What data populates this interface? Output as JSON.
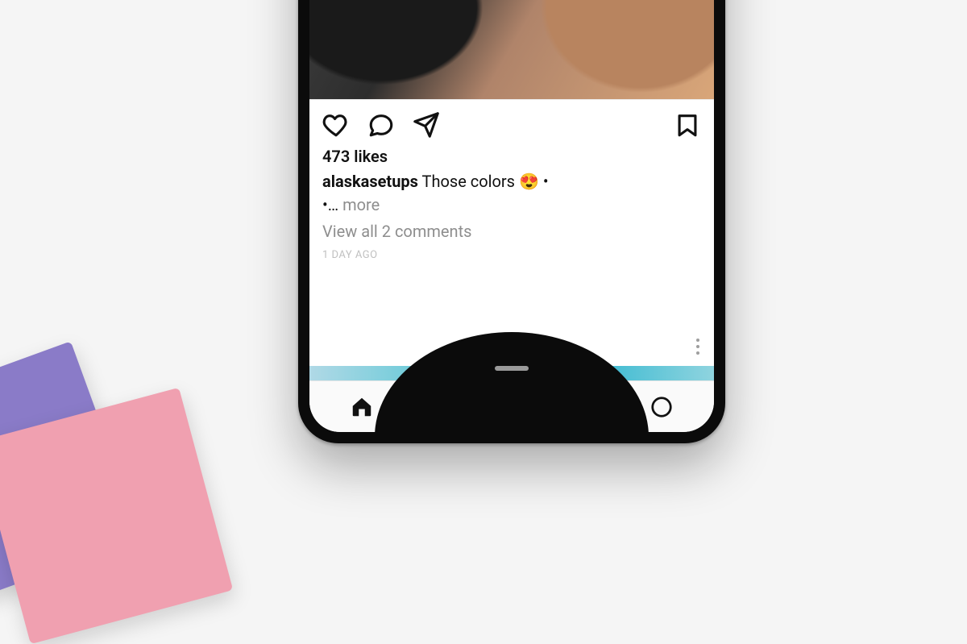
{
  "post": {
    "likes_text": "473 likes",
    "username": "alaskasetups",
    "caption": "Those colors 😍 •",
    "caption_line2_prefix": "•… ",
    "more_label": "more",
    "view_comments": "View all 2 comments",
    "timestamp": "1 DAY AGO"
  },
  "icons": {
    "like": "heart-icon",
    "comment": "comment-icon",
    "share": "share-icon",
    "save": "bookmark-icon",
    "home": "home-icon",
    "search": "search-icon",
    "add": "add-icon",
    "activity": "activity-icon",
    "profile": "profile-icon",
    "overflow": "overflow-icon"
  }
}
